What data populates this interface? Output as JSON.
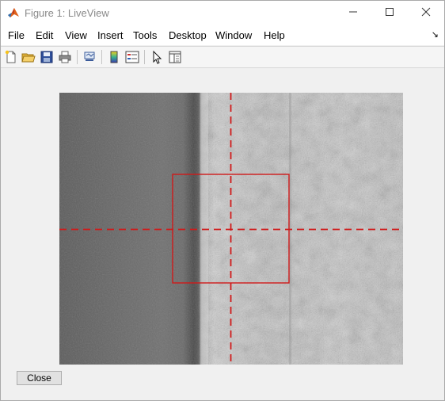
{
  "window": {
    "title": "Figure 1: LiveView"
  },
  "menu": {
    "items": [
      "File",
      "Edit",
      "View",
      "Insert",
      "Tools",
      "Desktop",
      "Window",
      "Help"
    ]
  },
  "toolbar": {
    "buttons": [
      "new-figure-icon",
      "open-file-icon",
      "save-icon",
      "print-icon",
      "link-plot-icon",
      "colorbar-icon",
      "legend-icon",
      "pointer-icon",
      "property-inspector-icon"
    ]
  },
  "figure": {
    "overlay_color": "#d01a1a",
    "close_label": "Close"
  }
}
